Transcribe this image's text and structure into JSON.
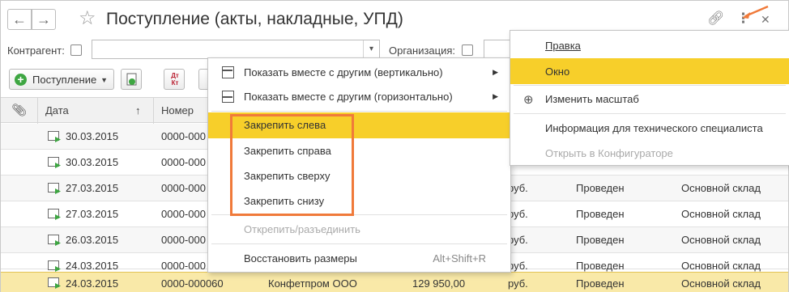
{
  "window": {
    "title": "Поступление (акты, накладные, УПД)",
    "icons": [
      "back-arrow-icon",
      "forward-arrow-icon",
      "star-icon",
      "link-icon",
      "more-icon",
      "close-icon"
    ]
  },
  "filters": {
    "counterparty_label": "Контрагент:",
    "organization_label": "Организация:"
  },
  "toolbar": {
    "add_label": "Поступление",
    "dtkt_top": "Дт",
    "dtkt_bottom": "Кт"
  },
  "table": {
    "columns": [
      "Дата",
      "Номер"
    ],
    "sort_indicator": "↑",
    "rows": [
      {
        "date": "30.03.2015",
        "number": "0000-000",
        "contractor": "",
        "sum": "",
        "cur": "",
        "status": "",
        "warehouse": ""
      },
      {
        "date": "30.03.2015",
        "number": "0000-000",
        "contractor": "",
        "sum": "",
        "cur": "",
        "status": "",
        "warehouse": ""
      },
      {
        "date": "27.03.2015",
        "number": "0000-000",
        "contractor": "",
        "sum": "",
        "cur": "руб.",
        "status": "Проведен",
        "warehouse": "Основной склад"
      },
      {
        "date": "27.03.2015",
        "number": "0000-000",
        "contractor": "",
        "sum": "",
        "cur": "руб.",
        "status": "Проведен",
        "warehouse": "Основной склад"
      },
      {
        "date": "26.03.2015",
        "number": "0000-000",
        "contractor": "",
        "sum": "",
        "cur": "руб.",
        "status": "Проведен",
        "warehouse": "Основной склад"
      },
      {
        "date": "24.03.2015",
        "number": "0000-000",
        "contractor": "",
        "sum": "",
        "cur": "руб.",
        "status": "Проведен",
        "warehouse": "Основной склад"
      },
      {
        "date": "24.03.2015",
        "number": "0000-000060",
        "contractor": "Конфетпром ООО",
        "sum": "129 950,00",
        "cur": "руб.",
        "status": "Проведен",
        "warehouse": "Основной склад"
      }
    ]
  },
  "menu_left": {
    "items": [
      {
        "label": "Показать вместе с другим (вертикально)"
      },
      {
        "label": "Показать вместе с другим (горизонтально)"
      },
      {
        "label": "Закрепить слева"
      },
      {
        "label": "Закрепить справа"
      },
      {
        "label": "Закрепить сверху"
      },
      {
        "label": "Закрепить снизу"
      },
      {
        "label": "Открепить/разъединить"
      },
      {
        "label": "Восстановить размеры",
        "shortcut": "Alt+Shift+R"
      }
    ]
  },
  "menu_right": {
    "items": [
      {
        "label": "Правка"
      },
      {
        "label": "Окно"
      },
      {
        "label": "Изменить масштаб"
      },
      {
        "label": "Информация для технического специалиста"
      },
      {
        "label": "Открыть в Конфигураторе"
      }
    ]
  },
  "colors": {
    "highlight": "#f7cf2a",
    "annotation": "#f07a3a",
    "selected_row": "#f9e9a8"
  }
}
